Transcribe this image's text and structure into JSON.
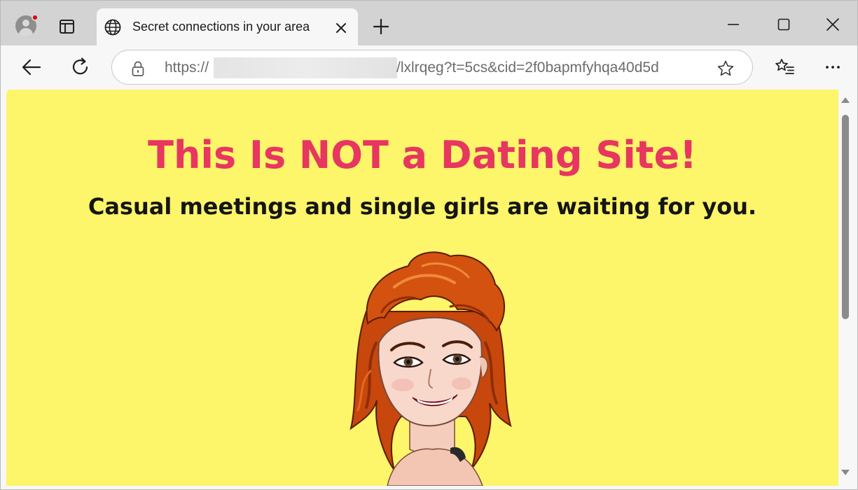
{
  "browser": {
    "tab": {
      "title": "Secret connections in your area",
      "icon": "globe-icon"
    },
    "profile": {
      "icon": "profile-avatar-icon",
      "notification": true
    },
    "address_bar": {
      "scheme": "https://",
      "path": "/lxlrqeg?t=5cs&cid=2f0bapmfyhqa40d5d",
      "host_redacted": true
    },
    "toolbar_icons": [
      "back-arrow-icon",
      "refresh-icon",
      "lock-icon",
      "star-icon",
      "favorites-icon",
      "more-icon"
    ],
    "window_controls": [
      "minimize-icon",
      "maximize-icon",
      "close-icon"
    ]
  },
  "page": {
    "background_color": "#fdf56a",
    "headline": "This Is NOT a Dating Site!",
    "headline_color": "#e7365f",
    "subheadline": "Casual meetings and single girls are waiting for you.",
    "hero_image": "cartoon-redhead-woman-illustration"
  }
}
